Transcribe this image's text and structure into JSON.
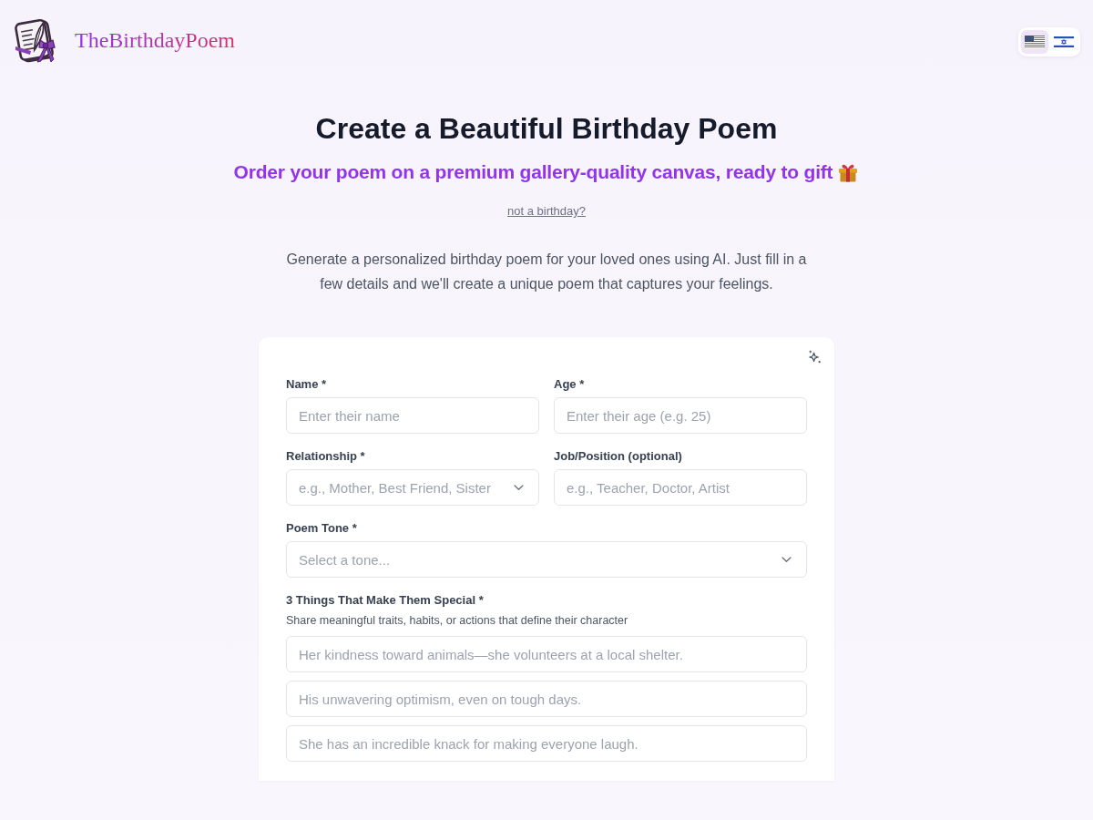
{
  "header": {
    "brand": "TheBirthdayPoem",
    "languages": [
      {
        "kind": "us",
        "selected": true
      },
      {
        "kind": "il",
        "selected": false
      }
    ]
  },
  "hero": {
    "title": "Create a Beautiful Birthday Poem",
    "subtitle": "Order your poem on a premium gallery-quality canvas, ready to gift",
    "link": "not a birthday?",
    "description": "Generate a personalized birthday poem for your loved ones using AI. Just fill in a few details and we'll create a unique poem that captures your feelings."
  },
  "form": {
    "rows": [
      {
        "fields": [
          {
            "kind": "text",
            "label": "Name *",
            "placeholder": "Enter their name"
          },
          {
            "kind": "text",
            "label": "Age *",
            "placeholder": "Enter their age (e.g. 25)"
          }
        ]
      },
      {
        "fields": [
          {
            "kind": "select",
            "label": "Relationship *",
            "placeholder": "e.g., Mother, Best Friend, Sister"
          },
          {
            "kind": "text",
            "label": "Job/Position (optional)",
            "placeholder": "e.g., Teacher, Doctor, Artist"
          }
        ]
      },
      {
        "fields": [
          {
            "kind": "select",
            "label": "Poem Tone *",
            "placeholder": "Select a tone..."
          }
        ]
      }
    ],
    "special": {
      "label": "3 Things That Make Them Special *",
      "hint": "Share meaningful traits, habits, or actions that define their character",
      "inputs": [
        {
          "placeholder": "Her kindness toward animals—she volunteers at a local shelter."
        },
        {
          "placeholder": "His unwavering optimism, even on tough days."
        },
        {
          "placeholder": "She has an incredible knack for making everyone laugh."
        }
      ]
    }
  }
}
